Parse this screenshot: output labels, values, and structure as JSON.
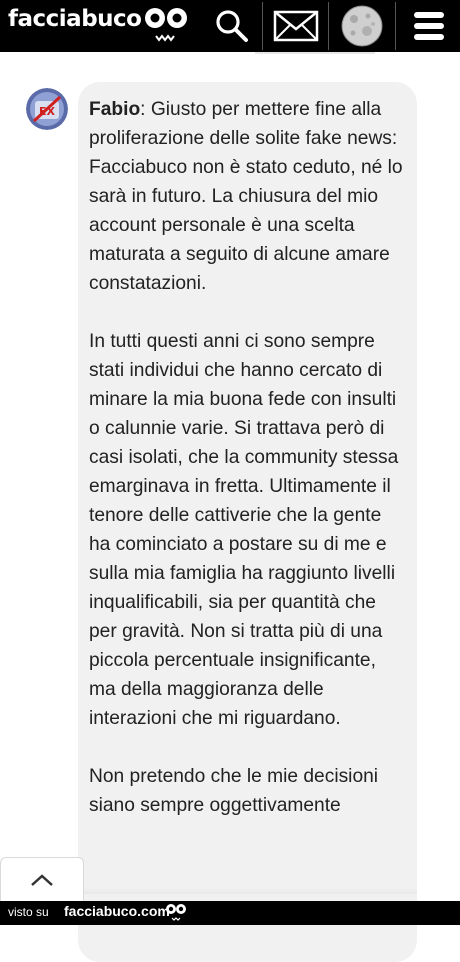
{
  "header": {
    "logo_text": "facciabuco",
    "icons": [
      "eyes-logo-icon",
      "search-icon",
      "mail-icon",
      "moon-avatar-icon",
      "menu-icon"
    ]
  },
  "comment": {
    "author": "Fabio",
    "separator": ": ",
    "paragraph_1": "Giusto per mettere fine alla proliferazione delle solite fake news: Facciabuco non è stato ceduto, né lo sarà in futuro. La chiusura del mio account personale è una scelta maturata a seguito di alcune amare constatazioni.",
    "paragraph_2": "In tutti questi anni ci sono sempre stati individui che hanno cercato di minare la mia buona fede con insulti o calunnie varie. Si trattava però di casi isolati, che la community stessa emarginava in fretta. Ultimamente il tenore delle cattiverie che la gente ha cominciato a postare su di me e sulla mia famiglia ha raggiunto livelli inqualificabili, sia per quantità che per gravità. Non si tratta più di una piccola percentuale insignificante, ma della maggioranza delle interazioni che mi riguardano.",
    "paragraph_3": "Non pretendo che le mie decisioni siano sempre oggettivamente"
  },
  "footer": {
    "visto_su": "visto su",
    "site": "facciabuco.com"
  },
  "colors": {
    "bar": "#000000",
    "bubble": "#f1f1f1",
    "text": "#222222"
  }
}
